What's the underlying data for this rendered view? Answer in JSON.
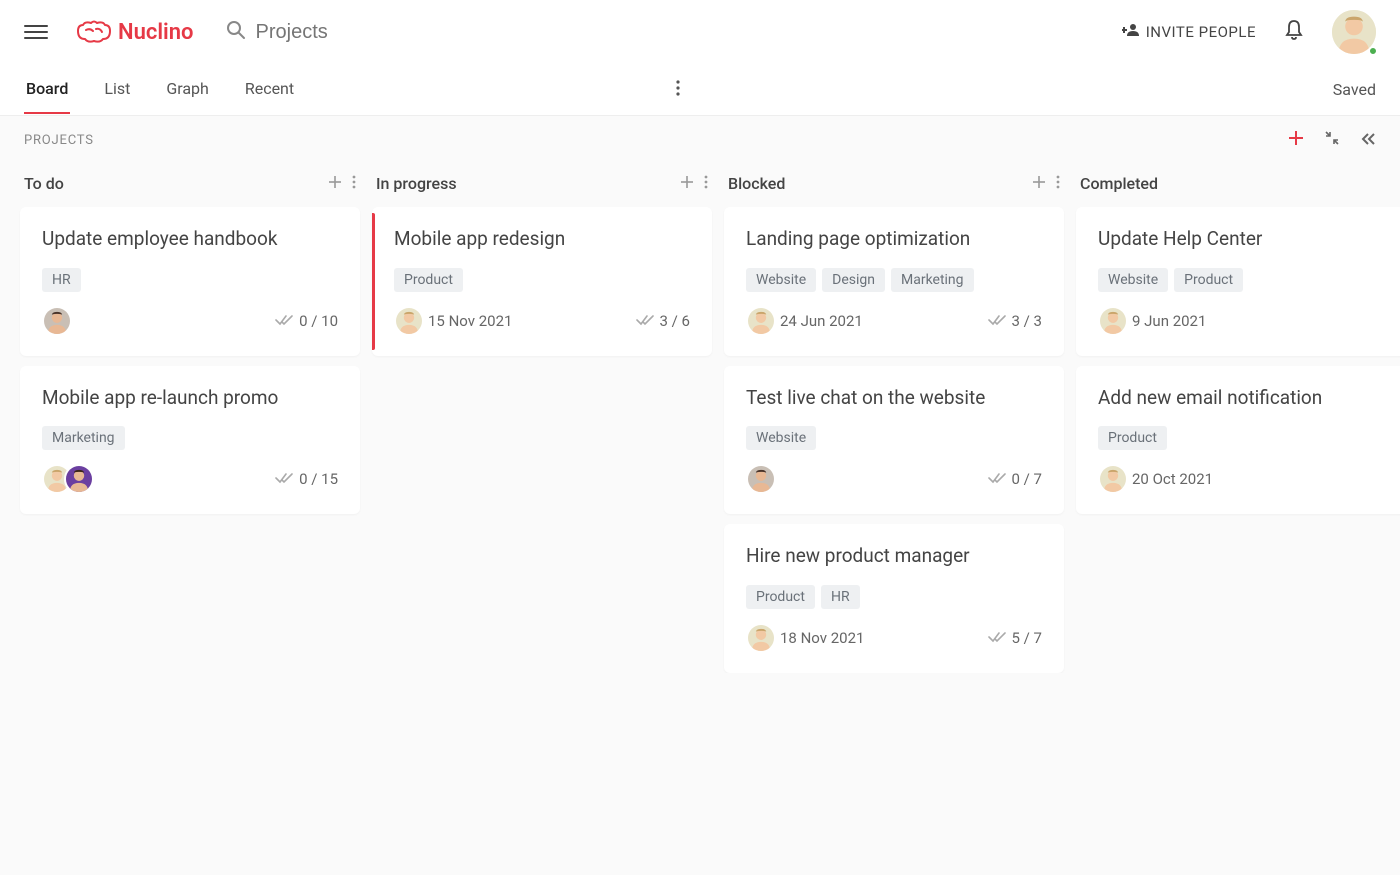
{
  "header": {
    "logo_text": "Nuclino",
    "search_placeholder": "Projects",
    "invite_label": "INVITE PEOPLE"
  },
  "tabbar": {
    "tabs": [
      "Board",
      "List",
      "Graph",
      "Recent"
    ],
    "active_tab": "Board",
    "status": "Saved"
  },
  "section": {
    "label": "PROJECTS"
  },
  "columns": [
    {
      "title": "To do",
      "has_actions": true,
      "cards": [
        {
          "title": "Update employee handbook",
          "tags": [
            "HR"
          ],
          "assignees": [
            "woman-glasses"
          ],
          "due": "",
          "progress": "0 / 10",
          "highlighted": false
        },
        {
          "title": "Mobile app re-launch promo",
          "tags": [
            "Marketing"
          ],
          "assignees": [
            "man-blond",
            "woman-purple"
          ],
          "due": "",
          "progress": "0 / 15",
          "highlighted": false
        }
      ]
    },
    {
      "title": "In progress",
      "has_actions": true,
      "cards": [
        {
          "title": "Mobile app redesign",
          "tags": [
            "Product"
          ],
          "assignees": [
            "man-blond"
          ],
          "due": "15 Nov 2021",
          "progress": "3 / 6",
          "highlighted": true
        }
      ]
    },
    {
      "title": "Blocked",
      "has_actions": true,
      "cards": [
        {
          "title": "Landing page optimization",
          "tags": [
            "Website",
            "Design",
            "Marketing"
          ],
          "assignees": [
            "man-blond"
          ],
          "due": "24 Jun 2021",
          "progress": "3 / 3",
          "highlighted": false
        },
        {
          "title": "Test live chat on the website",
          "tags": [
            "Website"
          ],
          "assignees": [
            "woman-glasses"
          ],
          "due": "",
          "progress": "0 / 7",
          "highlighted": false
        },
        {
          "title": "Hire new product manager",
          "tags": [
            "Product",
            "HR"
          ],
          "assignees": [
            "man-blond"
          ],
          "due": "18 Nov 2021",
          "progress": "5 / 7",
          "highlighted": false
        }
      ]
    },
    {
      "title": "Completed",
      "has_actions": false,
      "cards": [
        {
          "title": "Update Help Center",
          "tags": [
            "Website",
            "Product"
          ],
          "assignees": [
            "man-blond"
          ],
          "due": "9 Jun 2021",
          "progress": "",
          "highlighted": false
        },
        {
          "title": "Add new email notification",
          "tags": [
            "Product"
          ],
          "assignees": [
            "man-blond"
          ],
          "due": "20 Oct 2021",
          "progress": "",
          "highlighted": false
        }
      ]
    }
  ],
  "avatars": {
    "man-blond": {
      "bg": "#e8e3c8",
      "skin": "#f2c9a4",
      "hair": "#caa56b"
    },
    "woman-glasses": {
      "bg": "#c9bfb5",
      "skin": "#e8b894",
      "hair": "#4a342a"
    },
    "woman-purple": {
      "bg": "#6b3fa0",
      "skin": "#e8b894",
      "hair": "#3a2418"
    }
  }
}
